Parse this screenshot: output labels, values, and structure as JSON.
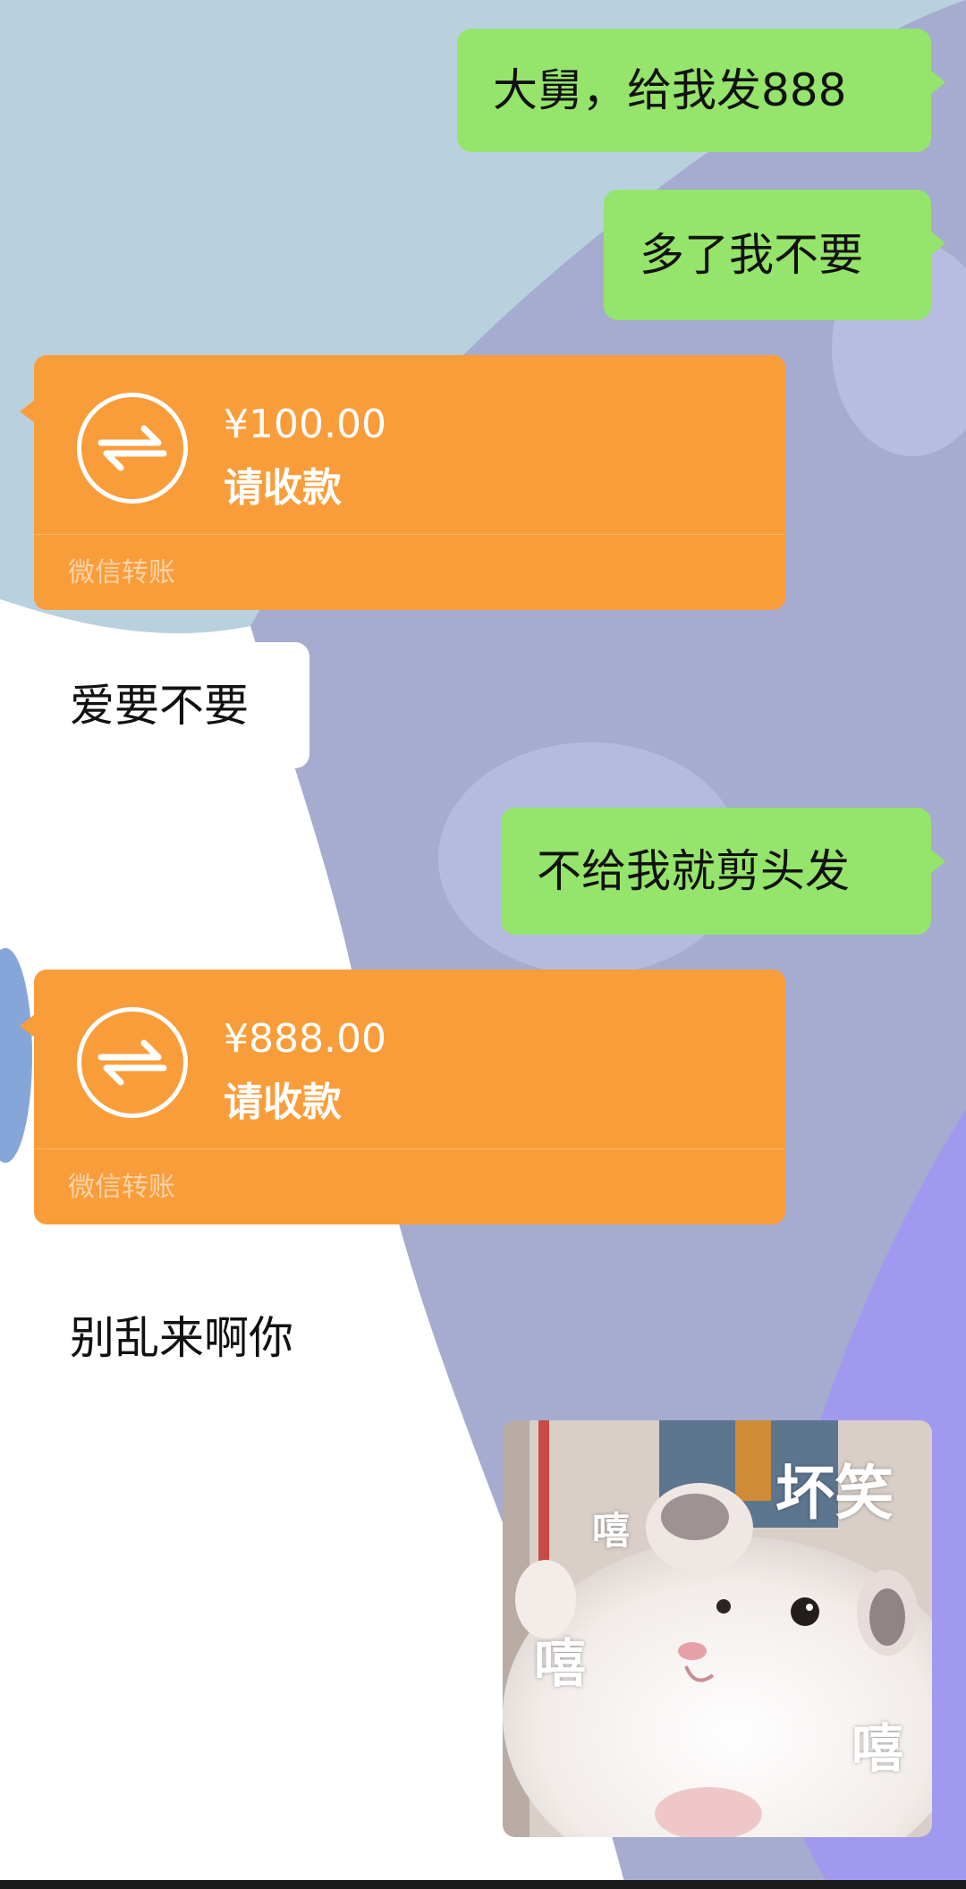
{
  "messages": [
    {
      "side": "right",
      "type": "text",
      "text": "大舅，给我发888"
    },
    {
      "side": "right",
      "type": "text",
      "text": "多了我不要"
    },
    {
      "side": "left",
      "type": "transfer",
      "amount": "¥100.00",
      "status": "请收款",
      "footer": "微信转账"
    },
    {
      "side": "left",
      "type": "text",
      "text": "爱要不要"
    },
    {
      "side": "right",
      "type": "text",
      "text": "不给我就剪头发"
    },
    {
      "side": "left",
      "type": "transfer",
      "amount": "¥888.00",
      "status": "请收款",
      "footer": "微信转账"
    },
    {
      "side": "left",
      "type": "text",
      "text": "别乱来啊你"
    },
    {
      "side": "right",
      "type": "sticker",
      "text_main": "坏笑",
      "text_a": "嘻",
      "text_b": "嘻",
      "text_c": "嘻"
    }
  ],
  "colors": {
    "background_sky": "#b9d1df",
    "background_lavender": "#a6abd0",
    "bubble_green": "#95e46b",
    "bubble_white": "#ffffff",
    "transfer_orange": "#f99d3b"
  },
  "icons": {
    "transfer": "transfer-arrows-icon"
  }
}
